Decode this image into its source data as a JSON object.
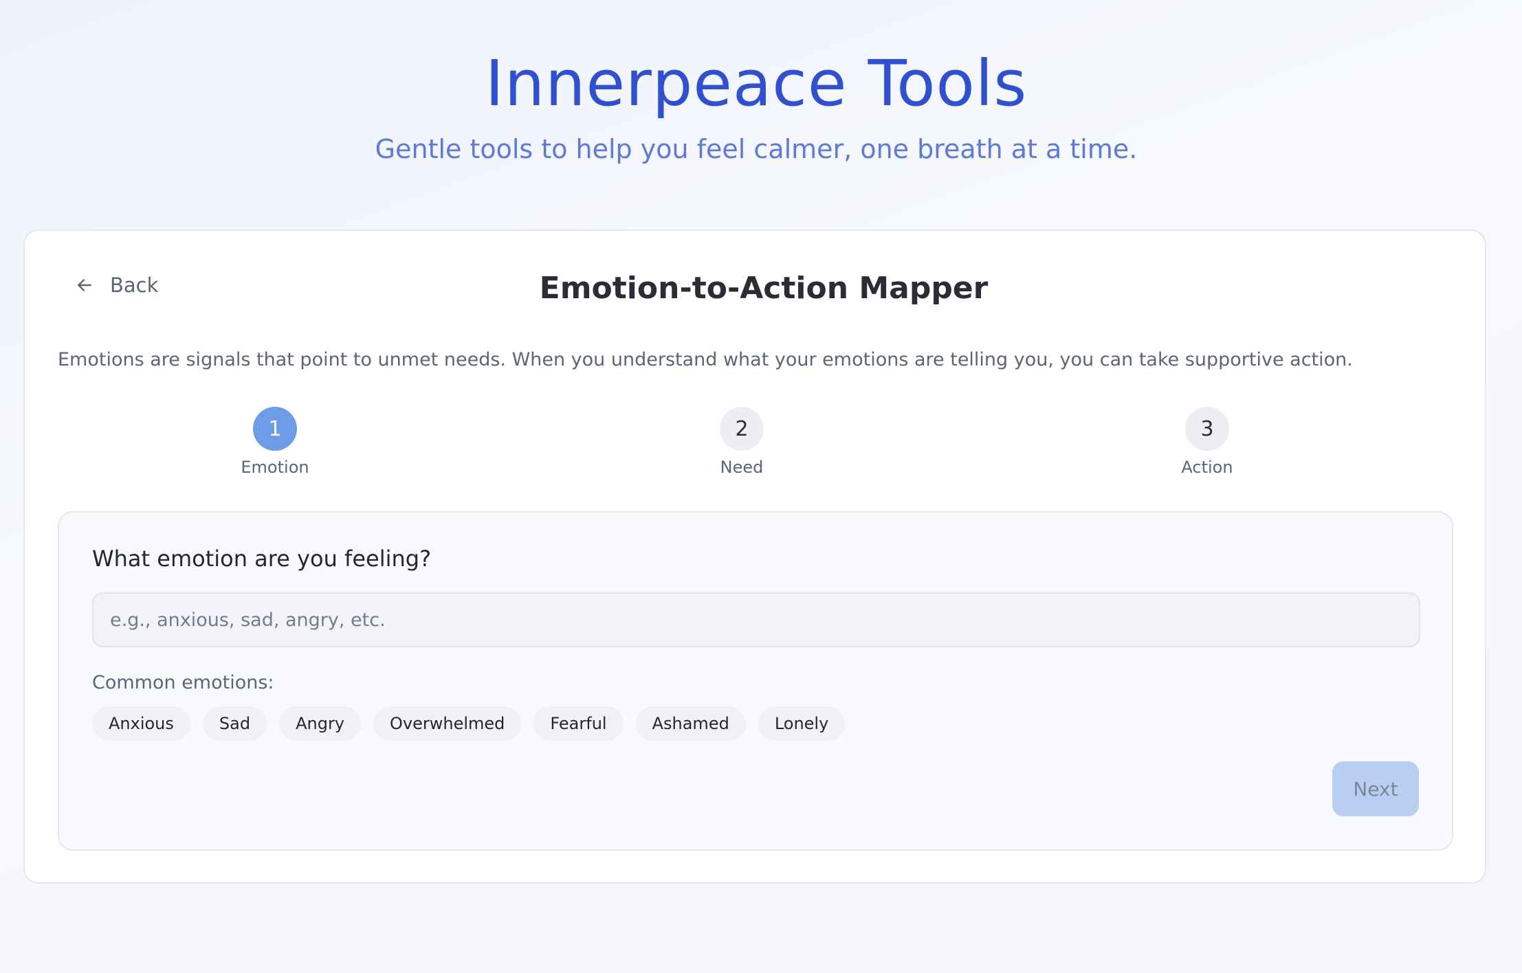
{
  "header": {
    "title": "Innerpeace Tools",
    "subtitle": "Gentle tools to help you feel calmer, one breath at a time."
  },
  "card": {
    "back_label": "Back",
    "title": "Emotion-to-Action Mapper",
    "intro": "Emotions are signals that point to unmet needs. When you understand what your emotions are telling you, you can take supportive action."
  },
  "steps": [
    {
      "number": "1",
      "label": "Emotion",
      "active": true
    },
    {
      "number": "2",
      "label": "Need",
      "active": false
    },
    {
      "number": "3",
      "label": "Action",
      "active": false
    }
  ],
  "form": {
    "question": "What emotion are you feeling?",
    "input_value": "",
    "input_placeholder": "e.g., anxious, sad, angry, etc.",
    "common_label": "Common emotions:",
    "chips": [
      "Anxious",
      "Sad",
      "Angry",
      "Overwhelmed",
      "Fearful",
      "Ashamed",
      "Lonely"
    ],
    "next_label": "Next",
    "next_enabled": false
  },
  "icons": {
    "back": "arrow-left-icon"
  },
  "colors": {
    "brand_title": "#2f4fd4",
    "subtitle": "#5b78e6",
    "step_active": "#6d9de8",
    "next_disabled": "#b8cff1"
  }
}
